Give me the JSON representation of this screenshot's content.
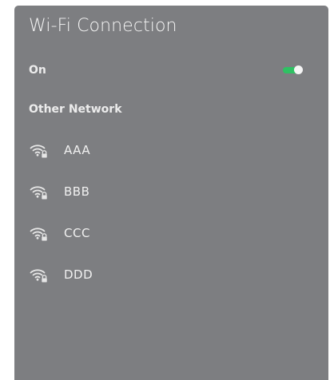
{
  "panel": {
    "title": "Wi-Fi Connection"
  },
  "wifi_toggle": {
    "label": "On",
    "state": true,
    "accent_color": "#2fc163"
  },
  "other_network": {
    "label": "Other Network"
  },
  "networks": [
    {
      "name": "AAA",
      "icon": "wifi-lock-icon"
    },
    {
      "name": "BBB",
      "icon": "wifi-lock-icon"
    },
    {
      "name": "CCC",
      "icon": "wifi-lock-icon"
    },
    {
      "name": "DDD",
      "icon": "wifi-lock-icon"
    }
  ],
  "colors": {
    "panel_background": "#7d7e81",
    "text": "#f2f2f2"
  }
}
